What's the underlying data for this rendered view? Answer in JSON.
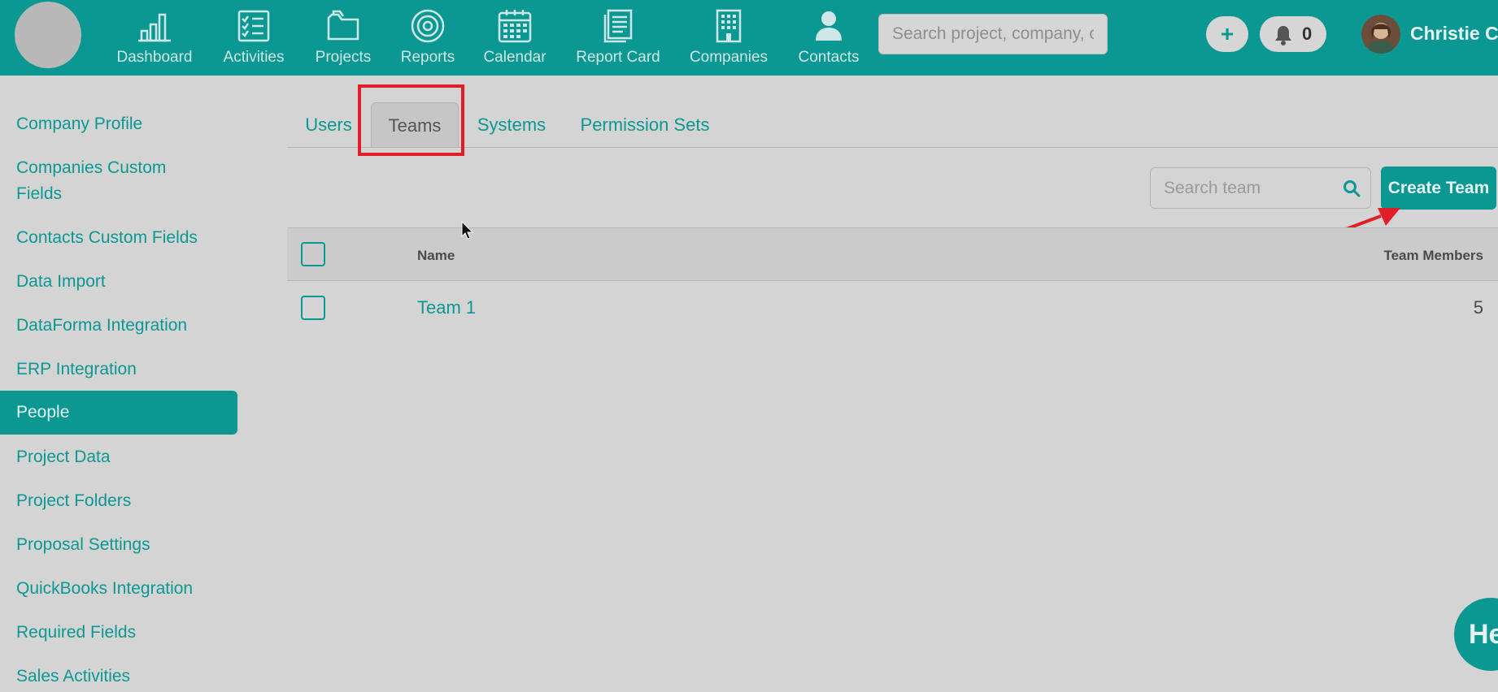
{
  "colors": {
    "accent": "#0b9893",
    "background": "#d4d4d4",
    "highlight": "#e01e27"
  },
  "nav": {
    "items": [
      {
        "label": "Dashboard",
        "icon": "bar-chart-icon"
      },
      {
        "label": "Activities",
        "icon": "checklist-icon"
      },
      {
        "label": "Projects",
        "icon": "folder-icon"
      },
      {
        "label": "Reports",
        "icon": "target-icon"
      },
      {
        "label": "Calendar",
        "icon": "calendar-icon"
      },
      {
        "label": "Report Card",
        "icon": "document-icon"
      },
      {
        "label": "Companies",
        "icon": "building-icon"
      },
      {
        "label": "Contacts",
        "icon": "person-icon"
      }
    ],
    "search_placeholder": "Search project, company, contact",
    "add_label": "+",
    "notification_count": "0",
    "user_name": "Christie Co"
  },
  "sidebar": {
    "items": [
      {
        "label": "Company Profile"
      },
      {
        "label": "Companies Custom Fields"
      },
      {
        "label": "Contacts Custom Fields"
      },
      {
        "label": "Data Import"
      },
      {
        "label": "DataForma Integration"
      },
      {
        "label": "ERP Integration"
      },
      {
        "label": "People",
        "active": true
      },
      {
        "label": "Project Data"
      },
      {
        "label": "Project Folders"
      },
      {
        "label": "Proposal Settings"
      },
      {
        "label": "QuickBooks Integration"
      },
      {
        "label": "Required Fields"
      },
      {
        "label": "Sales Activities"
      }
    ]
  },
  "tabs": [
    {
      "label": "Users"
    },
    {
      "label": "Teams",
      "active": true
    },
    {
      "label": "Systems"
    },
    {
      "label": "Permission Sets"
    }
  ],
  "toolbar": {
    "search_placeholder": "Search team",
    "create_label": "Create Team"
  },
  "table": {
    "columns": [
      "Name",
      "Team Members"
    ],
    "rows": [
      {
        "name": "Team 1",
        "members": "5"
      }
    ]
  },
  "help": {
    "label": "He"
  }
}
